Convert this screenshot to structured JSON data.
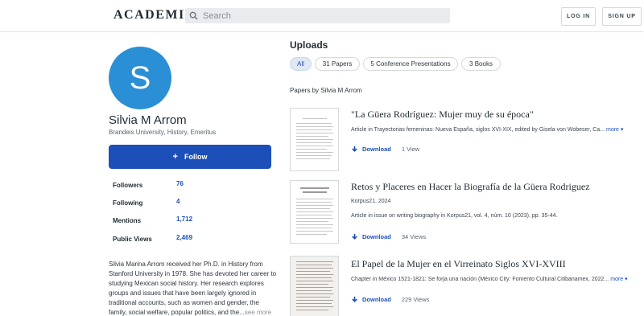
{
  "header": {
    "logo": "ACADEMIA",
    "search_placeholder": "Search",
    "login": "LOG IN",
    "signup": "SIGN UP"
  },
  "profile": {
    "avatar_letter": "S",
    "name": "Silvia M Arrom",
    "affiliation": "Brandeis University, History, Emeritus",
    "follow_label": "Follow",
    "stats": [
      {
        "label": "Followers",
        "value": "76"
      },
      {
        "label": "Following",
        "value": "4"
      },
      {
        "label": "Mentions",
        "value": "1,712"
      },
      {
        "label": "Public Views",
        "value": "2,469"
      }
    ],
    "bio": "Silvia Marina Arrom received her Ph.D. in History from Stanford University in 1978. She has devoted her career to studying Mexican social history. Her research explores groups and issues that have been largely ignored in traditional accounts, such as  women and gender, the family, social welfare, popular politics, and the...",
    "see_more": "see more"
  },
  "uploads": {
    "title": "Uploads",
    "filters": [
      "All",
      "31 Papers",
      "5 Conference Presentations",
      "3 Books"
    ],
    "papers_by": "Papers by Silvia M Arrom",
    "papers": [
      {
        "title": "\"La Güera Rodríguez: Mujer muy de su época\"",
        "meta1": "Article in Trayectorias femeninas: Nueva España, siglos XVI-XIX, edited by Gisela von Wobeser, Ca...",
        "more": "more",
        "meta2": "",
        "download": "Download",
        "views": "1 View"
      },
      {
        "title": "Retos y Placeres en Hacer la Biografía de la Güera Rodriguez",
        "meta1": "Korpus21, 2024",
        "more": "",
        "meta2": "Article in issue on writing biography in Korpus21, vol. 4, núm. 10 (2023), pp. 35-44.",
        "download": "Download",
        "views": "34 Views"
      },
      {
        "title": "El Papel de la Mujer en el Virreinato Siglos XVI-XVIII",
        "meta1": "Chapter in México 1521-1821: Se forja una nación (México City: Fomento Cultural Citibanamex, 2022...",
        "more": "more",
        "meta2": "",
        "download": "Download",
        "views": "229 Views"
      }
    ]
  },
  "colors": {
    "accent": "#1d4fb8",
    "avatar": "#2b8fd6",
    "pill_active": "#dfe8f4"
  }
}
